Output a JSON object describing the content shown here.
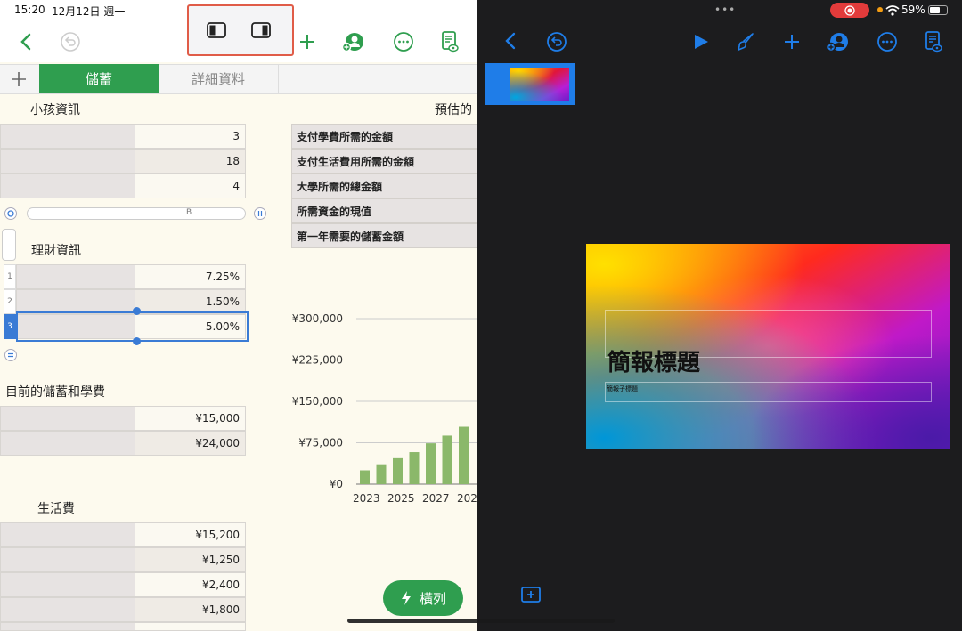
{
  "status": {
    "time": "15:20",
    "date": "12月12日 週一",
    "battery": "59%"
  },
  "colors": {
    "numbers_green": "#2f9e4f",
    "keynote_blue": "#1f7de8",
    "highlight_red": "#e05c48"
  },
  "numbers": {
    "tabs": [
      {
        "label": "儲蓄",
        "active": true
      },
      {
        "label": "詳細資料",
        "active": false
      }
    ],
    "kids_section": {
      "title": "小孩資訊",
      "values": [
        "3",
        "18",
        "4"
      ]
    },
    "estimate_title": "預估的",
    "estimate_rows": [
      "支付學費所需的金額",
      "支付生活費用所需的金額",
      "大學所需的總金額",
      "所需資金的現值",
      "第一年需要的儲蓄金額"
    ],
    "column_header": "B",
    "finance_section": {
      "title": "理財資訊",
      "rows": [
        {
          "num": "1",
          "value": "7.25%"
        },
        {
          "num": "2",
          "value": "1.50%"
        },
        {
          "num": "3",
          "value": "5.00%"
        }
      ]
    },
    "savings_section": {
      "title": "目前的儲蓄和學費",
      "values": [
        "¥15,000",
        "¥24,000"
      ]
    },
    "living_section": {
      "title": "生活費",
      "values": [
        "¥15,200",
        "¥1,250",
        "¥2,400",
        "¥1,800"
      ]
    },
    "fab_label": "橫列"
  },
  "chart_data": {
    "type": "bar",
    "y_ticks": [
      "¥300,000",
      "¥225,000",
      "¥150,000",
      "¥75,000",
      "¥0"
    ],
    "ylim": [
      0,
      300000
    ],
    "x_ticks": [
      "2023",
      "2025",
      "2027",
      "202"
    ],
    "values": [
      25000,
      36000,
      47000,
      58000,
      74000,
      88000,
      104000
    ],
    "bar_color": "#8bb86a"
  },
  "keynote": {
    "slide_number": "1",
    "slide_title": "簡報標題",
    "slide_subtitle": "簡報子標題"
  }
}
